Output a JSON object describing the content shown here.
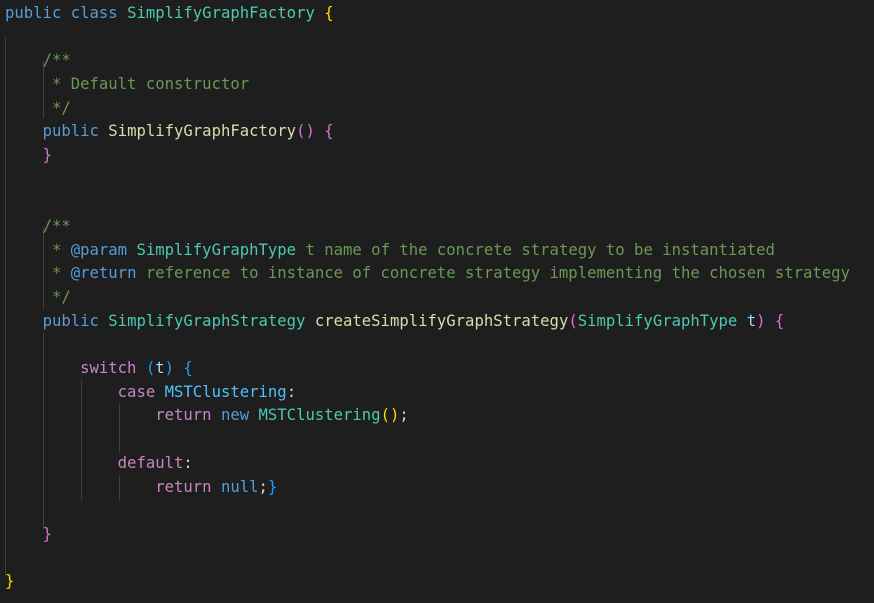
{
  "code": {
    "l01": {
      "a": "public",
      "b": "class",
      "c": "SimplifyGraphFactory",
      "d": "{"
    },
    "l02": {
      "a": "/**"
    },
    "l03": {
      "a": " * Default constructor"
    },
    "l04": {
      "a": " */"
    },
    "l05": {
      "a": "public",
      "b": "SimplifyGraphFactory",
      "c": "()",
      "d": "{"
    },
    "l06": {
      "a": "}"
    },
    "l07": {
      "a": "/**"
    },
    "l08": {
      "a": " * ",
      "b": "@param",
      "c": "SimplifyGraphType",
      "d": " t name of the concrete strategy to be instantiated"
    },
    "l09": {
      "a": " * ",
      "b": "@return",
      "c": " reference to instance of concrete strategy implementing the chosen strategy"
    },
    "l10": {
      "a": " */"
    },
    "l11": {
      "a": "public",
      "b": "SimplifyGraphStrategy",
      "c": "createSimplifyGraphStrategy",
      "d": "(",
      "e": "SimplifyGraphType",
      "f": "t",
      "g": ")",
      "h": "{"
    },
    "l12": {
      "a": "switch",
      "b": "(",
      "c": "t",
      "d": ")",
      "e": "{"
    },
    "l13": {
      "a": "case",
      "b": "MSTClustering",
      "c": ":"
    },
    "l14": {
      "a": "return",
      "b": "new",
      "c": "MSTClustering",
      "d": "()",
      "e": ";"
    },
    "l15": {
      "a": "default",
      "b": ":"
    },
    "l16": {
      "a": "return",
      "b": "null",
      "c": ";",
      "d": "}"
    },
    "l17": {
      "a": "}"
    },
    "l18": {
      "a": "}"
    }
  }
}
